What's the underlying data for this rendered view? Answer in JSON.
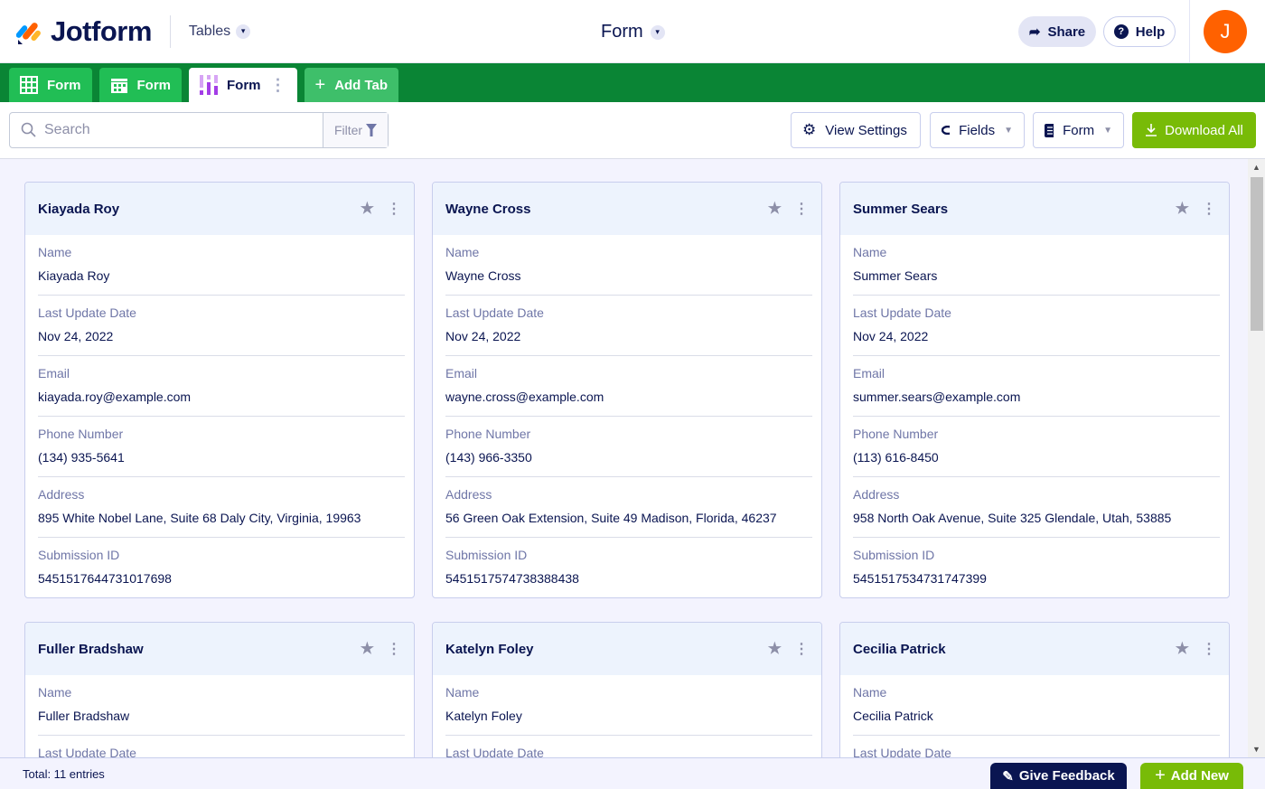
{
  "header": {
    "logo": "Jotform",
    "app_switcher": "Tables",
    "title": "Form",
    "share": "Share",
    "help": "Help",
    "avatar_initial": "J"
  },
  "tabs": [
    {
      "label": "Form",
      "icon": "grid-icon"
    },
    {
      "label": "Form",
      "icon": "calendar-icon"
    },
    {
      "label": "Form",
      "icon": "cards-icon",
      "active": true
    }
  ],
  "add_tab": "Add Tab",
  "toolbar": {
    "search_placeholder": "Search",
    "filter": "Filter",
    "view_settings": "View Settings",
    "fields": "Fields",
    "form": "Form",
    "download_all": "Download All"
  },
  "cards": [
    {
      "title": "Kiayada Roy",
      "fields": [
        {
          "label": "Name",
          "value": "Kiayada Roy"
        },
        {
          "label": "Last Update Date",
          "value": "Nov 24, 2022"
        },
        {
          "label": "Email",
          "value": "kiayada.roy@example.com"
        },
        {
          "label": "Phone Number",
          "value": "(134) 935-5641"
        },
        {
          "label": "Address",
          "value": "895 White Nobel Lane, Suite 68  Daly City, Virginia, 19963"
        },
        {
          "label": "Submission ID",
          "value": "5451517644731017698"
        }
      ]
    },
    {
      "title": "Wayne Cross",
      "fields": [
        {
          "label": "Name",
          "value": "Wayne Cross"
        },
        {
          "label": "Last Update Date",
          "value": "Nov 24, 2022"
        },
        {
          "label": "Email",
          "value": "wayne.cross@example.com"
        },
        {
          "label": "Phone Number",
          "value": "(143) 966-3350"
        },
        {
          "label": "Address",
          "value": "56 Green Oak Extension, Suite 49  Madison, Florida, 46237"
        },
        {
          "label": "Submission ID",
          "value": "5451517574738388438"
        }
      ]
    },
    {
      "title": "Summer Sears",
      "fields": [
        {
          "label": "Name",
          "value": "Summer Sears"
        },
        {
          "label": "Last Update Date",
          "value": "Nov 24, 2022"
        },
        {
          "label": "Email",
          "value": "summer.sears@example.com"
        },
        {
          "label": "Phone Number",
          "value": "(113) 616-8450"
        },
        {
          "label": "Address",
          "value": "958 North Oak Avenue, Suite 325  Glendale, Utah, 53885"
        },
        {
          "label": "Submission ID",
          "value": "5451517534731747399"
        }
      ]
    },
    {
      "title": "Fuller Bradshaw",
      "fields": [
        {
          "label": "Name",
          "value": "Fuller Bradshaw"
        },
        {
          "label": "Last Update Date"
        }
      ]
    },
    {
      "title": "Katelyn Foley",
      "fields": [
        {
          "label": "Name",
          "value": "Katelyn Foley"
        },
        {
          "label": "Last Update Date"
        }
      ]
    },
    {
      "title": "Cecilia Patrick",
      "fields": [
        {
          "label": "Name",
          "value": "Cecilia Patrick"
        },
        {
          "label": "Last Update Date"
        }
      ]
    }
  ],
  "footer": {
    "total": "Total: 11 entries",
    "feedback": "Give Feedback",
    "add_new": "Add New"
  }
}
